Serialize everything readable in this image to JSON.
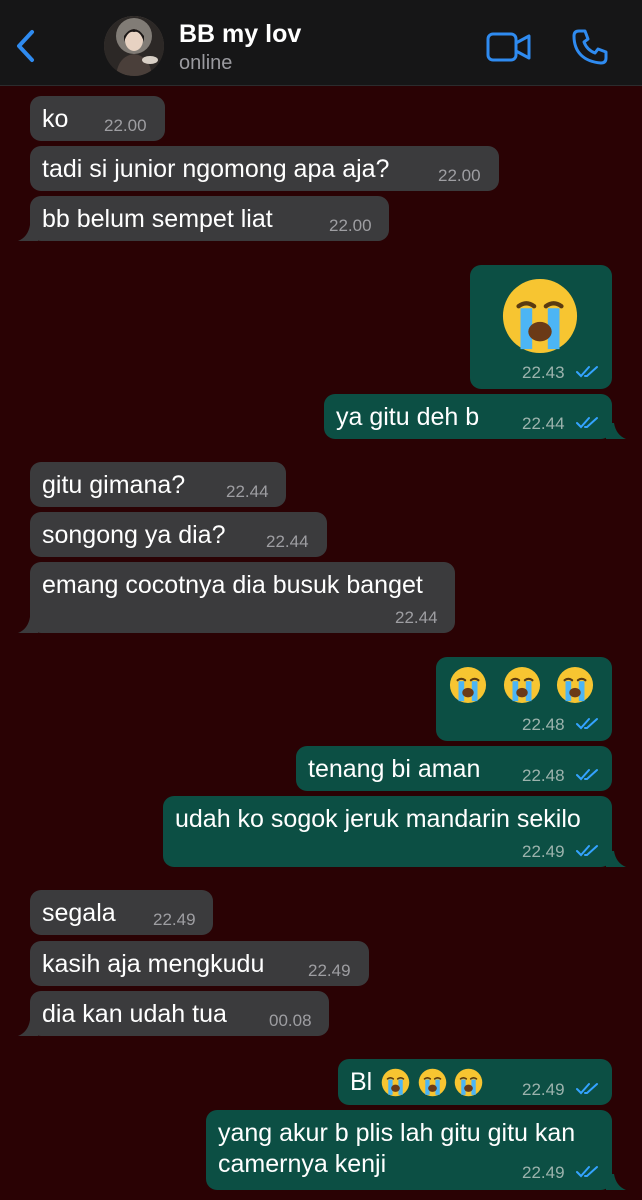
{
  "header": {
    "contact_name": "BB my lov",
    "status": "online",
    "icons": {
      "back": "chevron-left-icon",
      "video": "video-camera-icon",
      "call": "phone-icon"
    }
  },
  "colors": {
    "background": "#2a0204",
    "header": "#161617",
    "incoming_bubble": "#3b3b3d",
    "outgoing_bubble": "#0c4f44",
    "accent": "#2f8bf0",
    "read_ticks": "#34a3ff"
  },
  "messages": [
    {
      "dir": "in",
      "text": "ko",
      "time": "22.00"
    },
    {
      "dir": "in",
      "text": "tadi si junior ngomong apa aja?",
      "time": "22.00"
    },
    {
      "dir": "in",
      "text": "bb belum sempet liat",
      "time": "22.00"
    },
    {
      "dir": "out",
      "emoji": "crying-face",
      "text": "",
      "time": "22.43",
      "status": "read"
    },
    {
      "dir": "out",
      "text": "ya gitu deh b",
      "time": "22.44",
      "status": "read"
    },
    {
      "dir": "in",
      "text": "gitu gimana?",
      "time": "22.44"
    },
    {
      "dir": "in",
      "text": "songong ya dia?",
      "time": "22.44"
    },
    {
      "dir": "in",
      "text": "emang cocotnya dia busuk banget",
      "time": "22.44"
    },
    {
      "dir": "out",
      "emoji": "crying-face x3",
      "text": "",
      "time": "22.48",
      "status": "read"
    },
    {
      "dir": "out",
      "text": "tenang bi aman",
      "time": "22.48",
      "status": "read"
    },
    {
      "dir": "out",
      "text": "udah ko sogok jeruk mandarin sekilo",
      "time": "22.49",
      "status": "read"
    },
    {
      "dir": "in",
      "text": "segala",
      "time": "22.49"
    },
    {
      "dir": "in",
      "text": "kasih aja mengkudu",
      "time": "22.49"
    },
    {
      "dir": "in",
      "text": "dia kan udah tua",
      "time": "00.08"
    },
    {
      "dir": "out",
      "text": "Bl",
      "emoji": "crying-face x3",
      "time": "22.49",
      "status": "read"
    },
    {
      "dir": "out",
      "text": "yang akur b plis lah gitu gitu kan",
      "text_line2": "camernya kenji",
      "time": "22.49",
      "status": "read"
    }
  ]
}
